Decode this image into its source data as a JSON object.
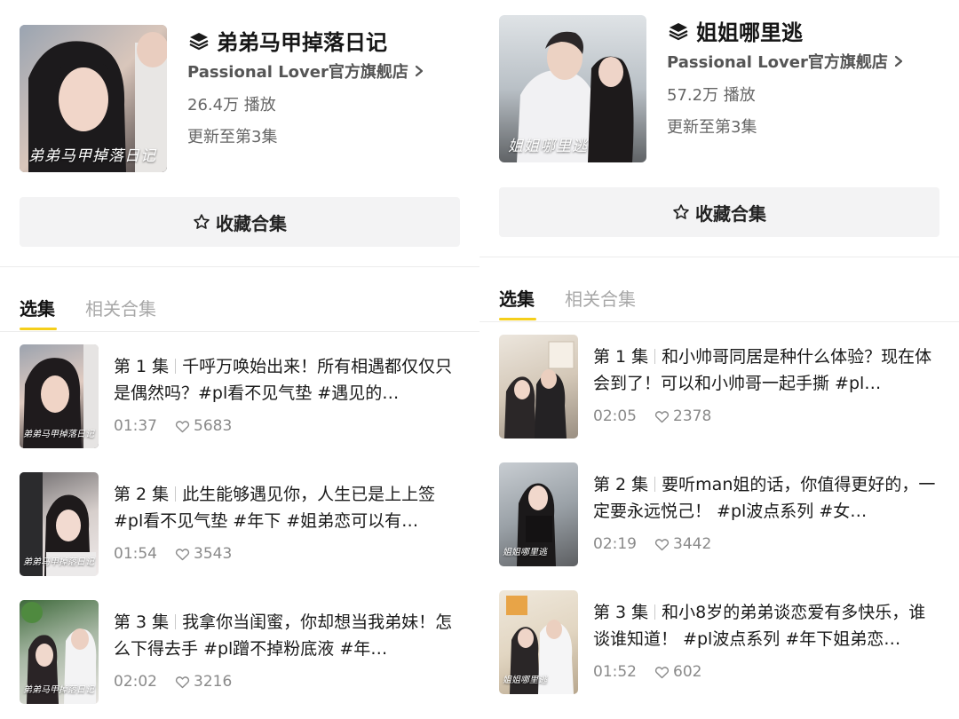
{
  "left": {
    "title": "弟弟马甲掉落日记",
    "cover_script": "弟弟马甲掉落日记",
    "shop": "Passional Lover官方旗舰店",
    "plays": "26.4万 播放",
    "update": "更新至第3集",
    "fav_label": "收藏合集",
    "tabs": [
      "选集",
      "相关合集"
    ],
    "episodes": [
      {
        "num": "第 1 集",
        "text": "千呼万唤始出来！所有相遇都仅仅只是偶然吗？#pl看不见气垫 #遇见的…",
        "duration": "01:37",
        "likes": "5683",
        "thumb_script": "弟弟马甲掉落日记"
      },
      {
        "num": "第 2 集",
        "text": "此生能够遇见你，人生已是上上签 #pl看不见气垫 #年下 #姐弟恋可以有…",
        "duration": "01:54",
        "likes": "3543",
        "thumb_script": "弟弟马甲掉落日记"
      },
      {
        "num": "第 3 集",
        "text": "我拿你当闺蜜，你却想当我弟妹！怎么下得去手 #pl蹭不掉粉底液 #年…",
        "duration": "02:02",
        "likes": "3216",
        "thumb_script": "弟弟马甲掉落日记"
      }
    ]
  },
  "right": {
    "title": "姐姐哪里逃",
    "cover_script": "姐姐哪里逃",
    "shop": "Passional Lover官方旗舰店",
    "plays": "57.2万 播放",
    "update": "更新至第3集",
    "fav_label": "收藏合集",
    "tabs": [
      "选集",
      "相关合集"
    ],
    "episodes": [
      {
        "num": "第 1 集",
        "text": "和小帅哥同居是种什么体验？现在体会到了！可以和小帅哥一起手撕 #pl…",
        "duration": "02:05",
        "likes": "2378",
        "thumb_script": ""
      },
      {
        "num": "第 2 集",
        "text": "要听man姐的话，你值得更好的，一定要永远悦己！ #pl波点系列 #女…",
        "duration": "02:19",
        "likes": "3442",
        "thumb_script": "姐姐哪里逃"
      },
      {
        "num": "第 3 集",
        "text": "和小8岁的弟弟谈恋爱有多快乐，谁谈谁知道！ #pl波点系列 #年下姐弟恋…",
        "duration": "01:52",
        "likes": "602",
        "thumb_script": "姐姐哪里逃"
      }
    ]
  },
  "colors": {
    "accent_underline": "#f5cf1b",
    "button_bg": "#f3f3f4",
    "muted_text": "#8a8a8a"
  },
  "icons": [
    "collection-stack-icon",
    "chevron-right-icon",
    "star-outline-icon",
    "heart-outline-icon"
  ]
}
